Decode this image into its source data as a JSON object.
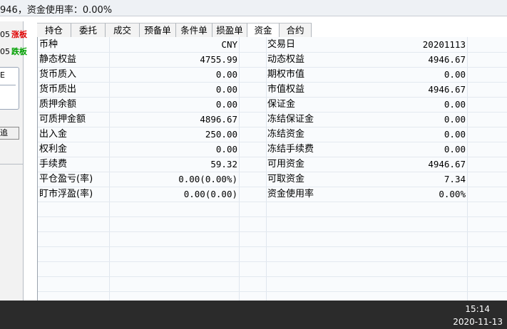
{
  "header": {
    "status_text": "946，资金使用率：0.00%"
  },
  "left_panel": {
    "rows": [
      {
        "num": "05",
        "tag": "涨板"
      },
      {
        "num": "05",
        "tag": "跌板"
      }
    ],
    "box_label": "E",
    "button_label": "追"
  },
  "tabs": [
    {
      "label": "持仓"
    },
    {
      "label": "委托"
    },
    {
      "label": "成交"
    },
    {
      "label": "预备单"
    },
    {
      "label": "条件单"
    },
    {
      "label": "损盈单"
    },
    {
      "label": "资金"
    },
    {
      "label": "合约"
    }
  ],
  "active_tab": "资金",
  "funds": [
    {
      "label1": "币种",
      "value1": "CNY",
      "label2": "交易日",
      "value2": "20201113"
    },
    {
      "label1": "静态权益",
      "value1": "4755.99",
      "label2": "动态权益",
      "value2": "4946.67"
    },
    {
      "label1": "货币质入",
      "value1": "0.00",
      "label2": "期权市值",
      "value2": "0.00"
    },
    {
      "label1": "货币质出",
      "value1": "0.00",
      "label2": "市值权益",
      "value2": "4946.67"
    },
    {
      "label1": "质押余额",
      "value1": "0.00",
      "label2": "保证金",
      "value2": "0.00"
    },
    {
      "label1": "可质押金额",
      "value1": "4896.67",
      "label2": "冻结保证金",
      "value2": "0.00"
    },
    {
      "label1": "出入金",
      "value1": "250.00",
      "label2": "冻结资金",
      "value2": "0.00"
    },
    {
      "label1": "权利金",
      "value1": "0.00",
      "label2": "冻结手续费",
      "value2": "0.00"
    },
    {
      "label1": "手续费",
      "value1": "59.32",
      "label2": "可用资金",
      "value2": "4946.67"
    },
    {
      "label1": "平仓盈亏(率)",
      "value1": "0.00(0.00%)",
      "label2": "可取资金",
      "value2": "7.34"
    },
    {
      "label1": "盯市浮盈(率)",
      "value1": "0.00(0.00)",
      "label2": "资金使用率",
      "value2": "0.00%"
    }
  ],
  "taskbar": {
    "time": "15:14",
    "date": "2020-11-13"
  },
  "colors": {
    "up": "#e00000",
    "down": "#00a000",
    "taskbar": "#2b2b2b"
  }
}
